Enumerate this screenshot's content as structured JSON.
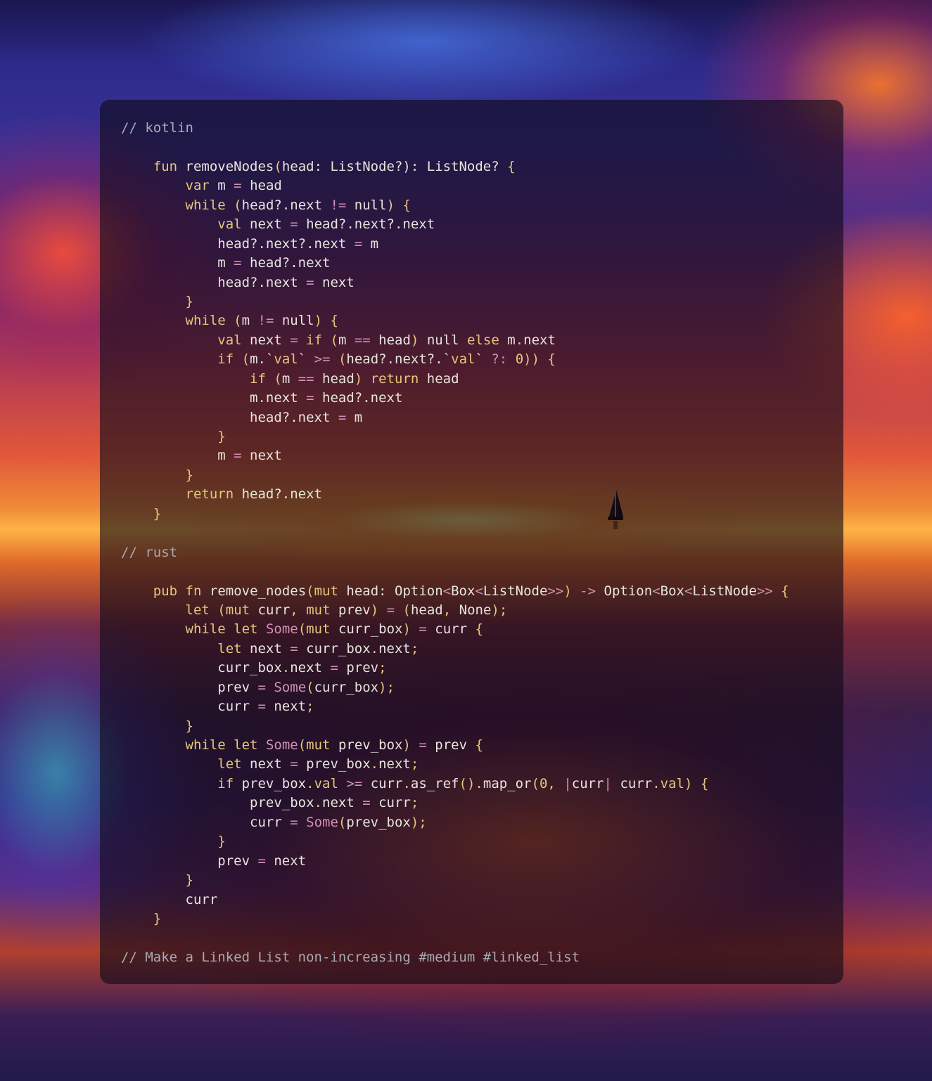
{
  "code": {
    "lines": [
      "// kotlin",
      "",
      "    fun removeNodes(head: ListNode?): ListNode? {",
      "        var m = head",
      "        while (head?.next != null) {",
      "            val next = head?.next?.next",
      "            head?.next?.next = m",
      "            m = head?.next",
      "            head?.next = next",
      "        }",
      "        while (m != null) {",
      "            val next = if (m == head) null else m.next",
      "            if (m.`val` >= (head?.next?.`val` ?: 0)) {",
      "                if (m == head) return head",
      "                m.next = head?.next",
      "                head?.next = m",
      "            }",
      "            m = next",
      "        }",
      "        return head?.next",
      "    }",
      "",
      "// rust",
      "",
      "    pub fn remove_nodes(mut head: Option<Box<ListNode>>) -> Option<Box<ListNode>> {",
      "        let (mut curr, mut prev) = (head, None);",
      "        while let Some(mut curr_box) = curr {",
      "            let next = curr_box.next;",
      "            curr_box.next = prev;",
      "            prev = Some(curr_box);",
      "            curr = next;",
      "        }",
      "        while let Some(mut prev_box) = prev {",
      "            let next = prev_box.next;",
      "            if prev_box.val >= curr.as_ref().map_or(0, |curr| curr.val) {",
      "                prev_box.next = curr;",
      "                curr = Some(prev_box);",
      "            }",
      "            prev = next",
      "        }",
      "        curr",
      "    }",
      "",
      "// Make a Linked List non-increasing #medium #linked_list"
    ]
  },
  "colors": {
    "comment": "#a8aab6",
    "keyword": "#e7c77a",
    "text": "#f3eee6",
    "operator": "#d48fb8",
    "panel": "rgba(14,10,22,0.62)"
  }
}
